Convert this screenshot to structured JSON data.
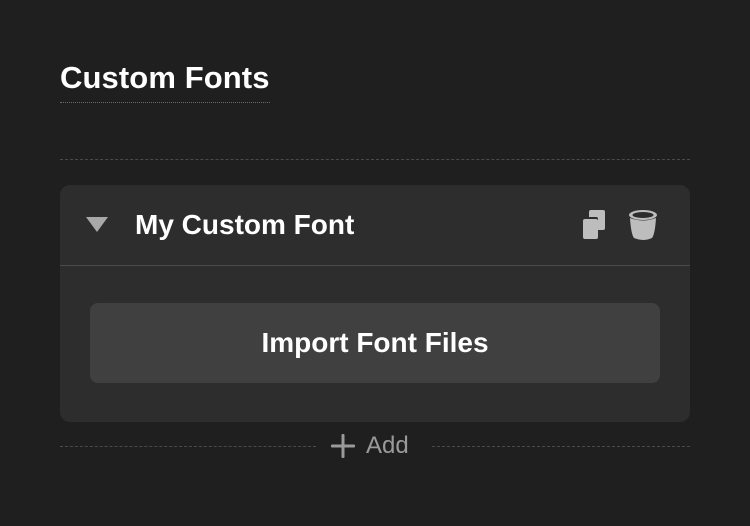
{
  "section": {
    "title": "Custom Fonts"
  },
  "font_card": {
    "name": "My Custom Font",
    "expanded": true,
    "toggle_icon": "triangle-down-icon",
    "duplicate_icon": "duplicate-icon",
    "delete_icon": "trash-icon",
    "import_label": "Import Font Files"
  },
  "add": {
    "label": "Add",
    "icon": "plus-icon"
  },
  "colors": {
    "background": "#1f1f1f",
    "card": "#2d2d2d",
    "button": "#404040",
    "text_primary": "#ffffff",
    "text_muted": "#9a9a9a",
    "icon": "#bdbdbd"
  }
}
